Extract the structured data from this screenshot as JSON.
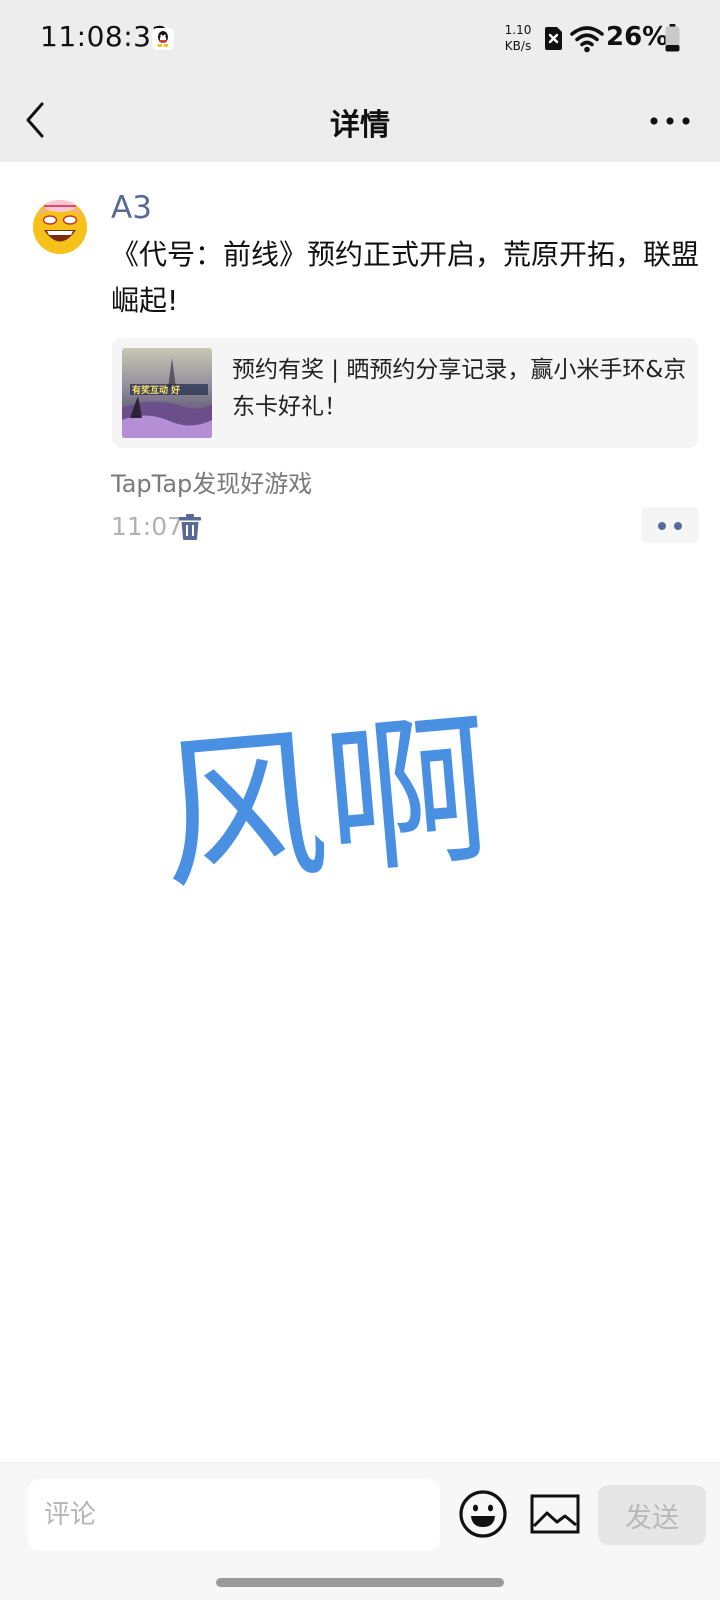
{
  "status_bar": {
    "time": "11:08:32",
    "net_speed_value": "1.10",
    "net_speed_unit": "KB/s",
    "battery": "26%"
  },
  "header": {
    "title": "详情"
  },
  "post": {
    "author": "A3",
    "text": "《代号：前线》预约正式开启，荒原开拓，联盟崛起!",
    "link_card": {
      "thumb_caption": "有奖互动 好",
      "title": "预约有奖 | 晒预约分享记录，赢小米手环&京东卡好礼！"
    },
    "source": "TapTap发现好游戏",
    "time": "11:07"
  },
  "watermark": {
    "text": "风啊",
    "color": "#4a90e2"
  },
  "comment_bar": {
    "placeholder": "评论",
    "send_label": "发送"
  },
  "colors": {
    "link_blue": "#576b95",
    "header_bg": "#ededed"
  }
}
